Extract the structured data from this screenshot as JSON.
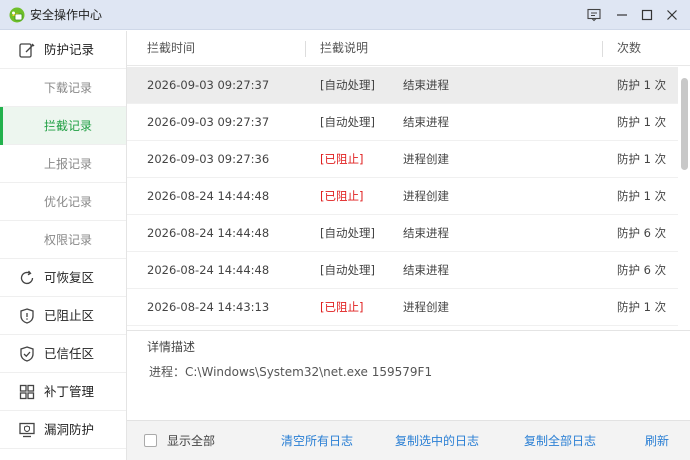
{
  "window": {
    "title": "安全操作中心",
    "colors": {
      "accent": "#22b14c",
      "link": "#2a7fd4",
      "blocked": "#e02020"
    }
  },
  "sidebar": {
    "sections": [
      {
        "icon": "edit-check-icon",
        "label": "防护记录"
      },
      {
        "icon": "restore-icon",
        "label": "可恢复区"
      },
      {
        "icon": "shield-block-icon",
        "label": "已阻止区"
      },
      {
        "icon": "shield-check-icon",
        "label": "已信任区"
      },
      {
        "icon": "grid-icon",
        "label": "补丁管理"
      },
      {
        "icon": "monitor-shield-icon",
        "label": "漏洞防护"
      }
    ],
    "sub_items": [
      "下载记录",
      "拦截记录",
      "上报记录",
      "优化记录",
      "权限记录"
    ]
  },
  "table": {
    "headers": {
      "time": "拦截时间",
      "desc": "拦截说明",
      "count": "次数"
    },
    "rows": [
      {
        "time": "2026-09-03 09:27:37",
        "status": "[自动处理]",
        "action": "结束进程",
        "count": "防护 1 次"
      },
      {
        "time": "2026-09-03 09:27:37",
        "status": "[自动处理]",
        "action": "结束进程",
        "count": "防护 1 次"
      },
      {
        "time": "2026-09-03 09:27:36",
        "status": "[已阻止]",
        "action": "进程创建",
        "count": "防护 1 次"
      },
      {
        "time": "2026-08-24 14:44:48",
        "status": "[已阻止]",
        "action": "进程创建",
        "count": "防护 1 次"
      },
      {
        "time": "2026-08-24 14:44:48",
        "status": "[自动处理]",
        "action": "结束进程",
        "count": "防护 6 次"
      },
      {
        "time": "2026-08-24 14:44:48",
        "status": "[自动处理]",
        "action": "结束进程",
        "count": "防护 6 次"
      },
      {
        "time": "2026-08-24 14:43:13",
        "status": "[已阻止]",
        "action": "进程创建",
        "count": "防护 1 次"
      }
    ]
  },
  "detail": {
    "title": "详情描述",
    "line": "进程：C:\\Windows\\System32\\net.exe 159579F1"
  },
  "footer": {
    "show_all": "显示全部",
    "clear_all": "清空所有日志",
    "copy_selected": "复制选中的日志",
    "copy_all": "复制全部日志",
    "refresh": "刷新"
  }
}
